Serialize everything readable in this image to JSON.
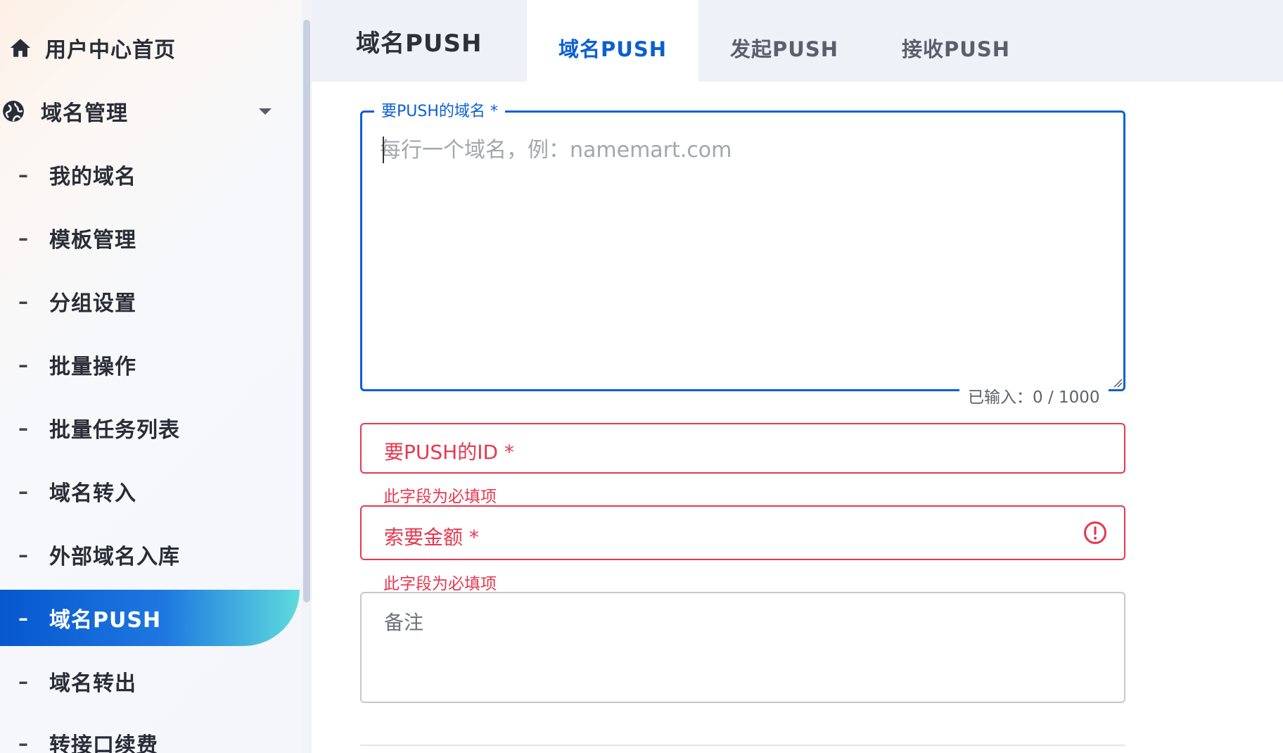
{
  "sidebar": {
    "home_label": "用户中心首页",
    "domain_mgmt_label": "域名管理",
    "items": [
      {
        "label": "我的域名"
      },
      {
        "label": "模板管理"
      },
      {
        "label": "分组设置"
      },
      {
        "label": "批量操作"
      },
      {
        "label": "批量任务列表"
      },
      {
        "label": "域名转入"
      },
      {
        "label": "外部域名入库"
      },
      {
        "label": "域名PUSH"
      },
      {
        "label": "域名转出"
      },
      {
        "label": "转接口续费"
      }
    ],
    "dash": "–"
  },
  "header": {
    "title": "域名PUSH",
    "tabs": [
      {
        "label": "域名PUSH"
      },
      {
        "label": "发起PUSH"
      },
      {
        "label": "接收PUSH"
      }
    ]
  },
  "form": {
    "domains_label": "要PUSH的域名 *",
    "domains_placeholder": "每行一个域名，例：namemart.com",
    "counter": "已输入：0 / 1000",
    "push_id_placeholder": "要PUSH的ID *",
    "push_id_error": "此字段为必填项",
    "amount_placeholder": "索要金额 *",
    "amount_error": "此字段为必填项",
    "remark_placeholder": "备注"
  },
  "colors": {
    "accent": "#0b5fd3",
    "error": "#e5384f",
    "sidebar_active_start": "#0757cf",
    "sidebar_active_end": "#5fdbdd"
  },
  "icons": {
    "home": "home-icon",
    "globe": "globe-icon",
    "caret": "caret-down-icon",
    "error": "error-circle-icon"
  }
}
